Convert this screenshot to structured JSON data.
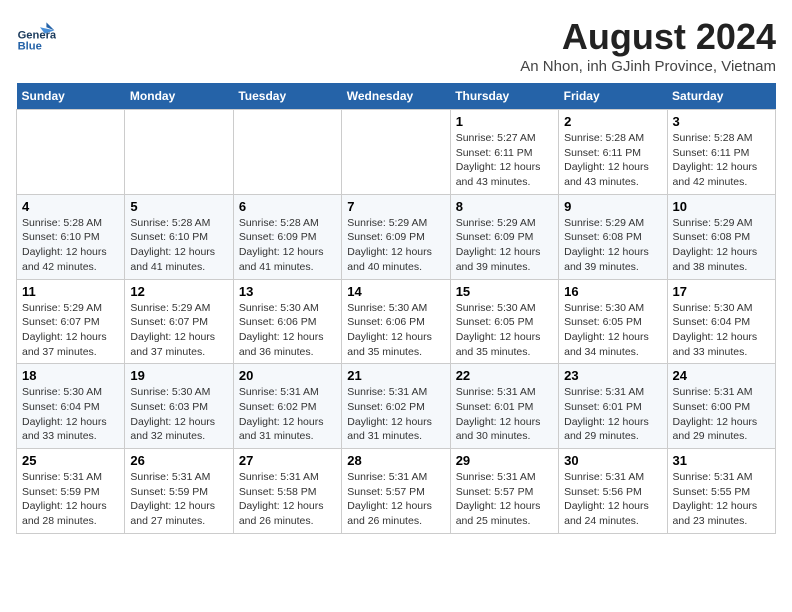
{
  "header": {
    "logo_general": "General",
    "logo_blue": "Blue",
    "title": "August 2024",
    "subtitle": "An Nhon, inh GJinh Province, Vietnam"
  },
  "days_of_week": [
    "Sunday",
    "Monday",
    "Tuesday",
    "Wednesday",
    "Thursday",
    "Friday",
    "Saturday"
  ],
  "weeks": [
    [
      {
        "day": "",
        "detail": ""
      },
      {
        "day": "",
        "detail": ""
      },
      {
        "day": "",
        "detail": ""
      },
      {
        "day": "",
        "detail": ""
      },
      {
        "day": "1",
        "detail": "Sunrise: 5:27 AM\nSunset: 6:11 PM\nDaylight: 12 hours\nand 43 minutes."
      },
      {
        "day": "2",
        "detail": "Sunrise: 5:28 AM\nSunset: 6:11 PM\nDaylight: 12 hours\nand 43 minutes."
      },
      {
        "day": "3",
        "detail": "Sunrise: 5:28 AM\nSunset: 6:11 PM\nDaylight: 12 hours\nand 42 minutes."
      }
    ],
    [
      {
        "day": "4",
        "detail": "Sunrise: 5:28 AM\nSunset: 6:10 PM\nDaylight: 12 hours\nand 42 minutes."
      },
      {
        "day": "5",
        "detail": "Sunrise: 5:28 AM\nSunset: 6:10 PM\nDaylight: 12 hours\nand 41 minutes."
      },
      {
        "day": "6",
        "detail": "Sunrise: 5:28 AM\nSunset: 6:09 PM\nDaylight: 12 hours\nand 41 minutes."
      },
      {
        "day": "7",
        "detail": "Sunrise: 5:29 AM\nSunset: 6:09 PM\nDaylight: 12 hours\nand 40 minutes."
      },
      {
        "day": "8",
        "detail": "Sunrise: 5:29 AM\nSunset: 6:09 PM\nDaylight: 12 hours\nand 39 minutes."
      },
      {
        "day": "9",
        "detail": "Sunrise: 5:29 AM\nSunset: 6:08 PM\nDaylight: 12 hours\nand 39 minutes."
      },
      {
        "day": "10",
        "detail": "Sunrise: 5:29 AM\nSunset: 6:08 PM\nDaylight: 12 hours\nand 38 minutes."
      }
    ],
    [
      {
        "day": "11",
        "detail": "Sunrise: 5:29 AM\nSunset: 6:07 PM\nDaylight: 12 hours\nand 37 minutes."
      },
      {
        "day": "12",
        "detail": "Sunrise: 5:29 AM\nSunset: 6:07 PM\nDaylight: 12 hours\nand 37 minutes."
      },
      {
        "day": "13",
        "detail": "Sunrise: 5:30 AM\nSunset: 6:06 PM\nDaylight: 12 hours\nand 36 minutes."
      },
      {
        "day": "14",
        "detail": "Sunrise: 5:30 AM\nSunset: 6:06 PM\nDaylight: 12 hours\nand 35 minutes."
      },
      {
        "day": "15",
        "detail": "Sunrise: 5:30 AM\nSunset: 6:05 PM\nDaylight: 12 hours\nand 35 minutes."
      },
      {
        "day": "16",
        "detail": "Sunrise: 5:30 AM\nSunset: 6:05 PM\nDaylight: 12 hours\nand 34 minutes."
      },
      {
        "day": "17",
        "detail": "Sunrise: 5:30 AM\nSunset: 6:04 PM\nDaylight: 12 hours\nand 33 minutes."
      }
    ],
    [
      {
        "day": "18",
        "detail": "Sunrise: 5:30 AM\nSunset: 6:04 PM\nDaylight: 12 hours\nand 33 minutes."
      },
      {
        "day": "19",
        "detail": "Sunrise: 5:30 AM\nSunset: 6:03 PM\nDaylight: 12 hours\nand 32 minutes."
      },
      {
        "day": "20",
        "detail": "Sunrise: 5:31 AM\nSunset: 6:02 PM\nDaylight: 12 hours\nand 31 minutes."
      },
      {
        "day": "21",
        "detail": "Sunrise: 5:31 AM\nSunset: 6:02 PM\nDaylight: 12 hours\nand 31 minutes."
      },
      {
        "day": "22",
        "detail": "Sunrise: 5:31 AM\nSunset: 6:01 PM\nDaylight: 12 hours\nand 30 minutes."
      },
      {
        "day": "23",
        "detail": "Sunrise: 5:31 AM\nSunset: 6:01 PM\nDaylight: 12 hours\nand 29 minutes."
      },
      {
        "day": "24",
        "detail": "Sunrise: 5:31 AM\nSunset: 6:00 PM\nDaylight: 12 hours\nand 29 minutes."
      }
    ],
    [
      {
        "day": "25",
        "detail": "Sunrise: 5:31 AM\nSunset: 5:59 PM\nDaylight: 12 hours\nand 28 minutes."
      },
      {
        "day": "26",
        "detail": "Sunrise: 5:31 AM\nSunset: 5:59 PM\nDaylight: 12 hours\nand 27 minutes."
      },
      {
        "day": "27",
        "detail": "Sunrise: 5:31 AM\nSunset: 5:58 PM\nDaylight: 12 hours\nand 26 minutes."
      },
      {
        "day": "28",
        "detail": "Sunrise: 5:31 AM\nSunset: 5:57 PM\nDaylight: 12 hours\nand 26 minutes."
      },
      {
        "day": "29",
        "detail": "Sunrise: 5:31 AM\nSunset: 5:57 PM\nDaylight: 12 hours\nand 25 minutes."
      },
      {
        "day": "30",
        "detail": "Sunrise: 5:31 AM\nSunset: 5:56 PM\nDaylight: 12 hours\nand 24 minutes."
      },
      {
        "day": "31",
        "detail": "Sunrise: 5:31 AM\nSunset: 5:55 PM\nDaylight: 12 hours\nand 23 minutes."
      }
    ]
  ]
}
